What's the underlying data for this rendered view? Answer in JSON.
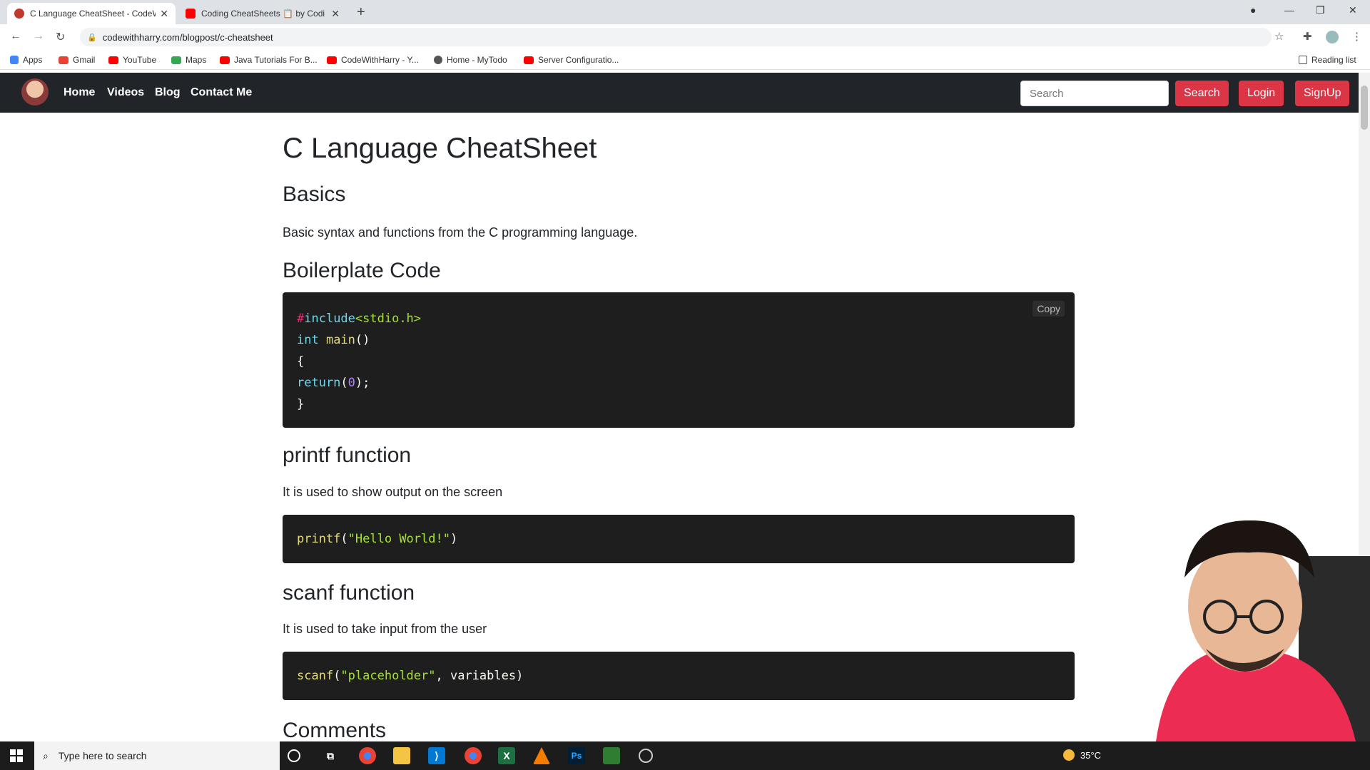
{
  "browser": {
    "tabs": [
      {
        "title": "C Language CheatSheet - CodeW",
        "favicon_color": "#c0392b"
      },
      {
        "title": "Coding CheatSheets 📋 by Codi",
        "favicon_color": "#ff0000"
      }
    ],
    "url": "codewithharry.com/blogpost/c-cheatsheet",
    "bookmarks": [
      {
        "label": "Apps",
        "color": "#4285f4"
      },
      {
        "label": "Gmail",
        "color": "#ea4335"
      },
      {
        "label": "YouTube",
        "color": "#ff0000"
      },
      {
        "label": "Maps",
        "color": "#34a853"
      },
      {
        "label": "Java Tutorials For B...",
        "color": "#ff0000"
      },
      {
        "label": "CodeWithHarry - Y...",
        "color": "#ff0000"
      },
      {
        "label": "Home - MyTodo",
        "color": "#555555"
      },
      {
        "label": "Server Configuratio...",
        "color": "#ff0000"
      }
    ],
    "reading_list": "Reading list"
  },
  "navbar": {
    "links": [
      "Home",
      "Videos",
      "Blog",
      "Contact Me"
    ],
    "search_placeholder": "Search",
    "search_button": "Search",
    "login_button": "Login",
    "signup_button": "SignUp",
    "accent": "#dc3545"
  },
  "page": {
    "title": "C Language CheatSheet",
    "sections": {
      "basics": {
        "heading": "Basics",
        "text": "Basic syntax and functions from the C programming language."
      },
      "boilerplate": {
        "heading": "Boilerplate Code",
        "copy_label": "Copy"
      },
      "printf": {
        "heading": "printf function",
        "text": "It is used to show output on the screen"
      },
      "scanf": {
        "heading": "scanf function",
        "text": "It is used to take input from the user"
      },
      "comments": {
        "heading": "Comments"
      }
    },
    "code": {
      "boilerplate": {
        "l1_pp": "#",
        "l1_kw": "include",
        "l1_rest": "<stdio.h>",
        "l2_kw": "int",
        "l2_fn": " main",
        "l2_rest": "()",
        "l3": "{",
        "l4_kw": "return",
        "l4_a": "(",
        "l4_num": "0",
        "l4_b": ");",
        "l5": "}"
      },
      "printf": {
        "fn": "printf",
        "a": "(",
        "str": "\"Hello World!\"",
        "b": ")"
      },
      "scanf": {
        "fn": "scanf",
        "a": "(",
        "str": "\"placeholder\"",
        "b": ", variables)"
      }
    }
  },
  "taskbar": {
    "search_placeholder": "Type here to search",
    "weather": "35°C"
  }
}
